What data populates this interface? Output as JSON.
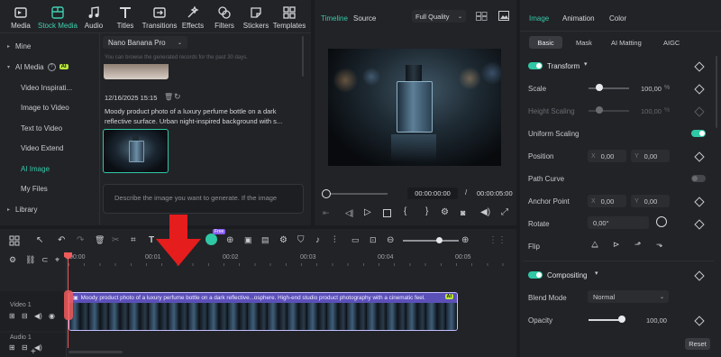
{
  "toolbar": {
    "items": [
      {
        "label": "Media",
        "icon": "media-icon"
      },
      {
        "label": "Stock Media",
        "icon": "stock-media-icon"
      },
      {
        "label": "Audio",
        "icon": "audio-icon"
      },
      {
        "label": "Titles",
        "icon": "titles-icon"
      },
      {
        "label": "Transitions",
        "icon": "transitions-icon"
      },
      {
        "label": "Effects",
        "icon": "effects-icon"
      },
      {
        "label": "Filters",
        "icon": "filters-icon"
      },
      {
        "label": "Stickers",
        "icon": "stickers-icon"
      },
      {
        "label": "Templates",
        "icon": "templates-icon"
      }
    ]
  },
  "sidebar": {
    "items": [
      {
        "label": "Mine"
      },
      {
        "label": "AI Media"
      },
      {
        "label": "Video Inspirati..."
      },
      {
        "label": "Image to Video"
      },
      {
        "label": "Text to Video"
      },
      {
        "label": "Video Extend"
      },
      {
        "label": "AI Image"
      },
      {
        "label": "My Files"
      },
      {
        "label": "Library"
      }
    ],
    "ai_badge": "AI"
  },
  "generator": {
    "model": "Nano Banana Pro",
    "history_note": "You can browse the generated records for the past 30 days.",
    "record_date": "12/16/2025 15:15",
    "record_prompt_line1": "Moody product photo of a luxury perfume bottle on a dark",
    "record_prompt_line2": "reflective surface. Urban night-inspired background with s...",
    "prompt_placeholder": "Describe the image you want to generate. If the image"
  },
  "preview": {
    "tab_timeline": "Timeline",
    "tab_source": "Source",
    "quality": "Full Quality",
    "current_time": "00:00:00:00",
    "separator": "/",
    "total_time": "00:00:05:00"
  },
  "timeline": {
    "ruler": [
      "00:00",
      "00:01",
      "00:02",
      "00:03",
      "00:04",
      "00:05"
    ],
    "track_video": "Video 1",
    "track_audio": "Audio 1",
    "clip_title": "Moody product photo of a luxury perfume bottle on a dark reflective...osphere. High-end studio product photography with a cinematic feel.",
    "clip_ai_badge": "AI",
    "new_badge": "Free"
  },
  "inspector": {
    "tabs": [
      "Image",
      "Animation",
      "Color"
    ],
    "subtabs": [
      "Basic",
      "Mask",
      "AI Matting",
      "AIGC"
    ],
    "transform_title": "Transform",
    "scale_label": "Scale",
    "scale_value": "100,00",
    "scale_unit": "%",
    "height_label": "Height Scaling",
    "height_value": "100,00",
    "height_unit": "%",
    "uniform_label": "Uniform Scaling",
    "position_label": "Position",
    "position_x": "0,00",
    "position_y": "0,00",
    "x_label": "X",
    "y_label": "Y",
    "path_label": "Path Curve",
    "anchor_label": "Anchor Point",
    "anchor_x": "0,00",
    "anchor_y": "0,00",
    "rotate_label": "Rotate",
    "rotate_value": "0,00°",
    "flip_label": "Flip",
    "compositing_title": "Compositing",
    "blend_label": "Blend Mode",
    "blend_value": "Normal",
    "opacity_label": "Opacity",
    "opacity_value": "100,00",
    "reset_label": "Reset"
  },
  "colors": {
    "accent": "#2fc7a5",
    "clip": "#5b4fb8",
    "playhead": "#f05a5a",
    "arrow": "#e51d1d"
  }
}
